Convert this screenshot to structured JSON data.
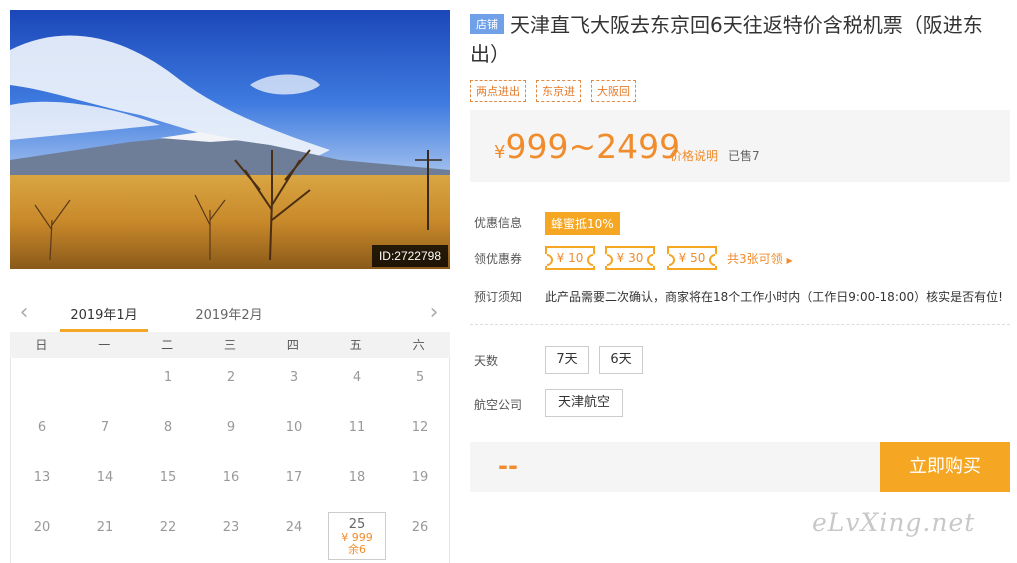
{
  "product": {
    "image_id": "ID:2722798",
    "shop_badge": "店铺",
    "title": "天津直飞大阪去东京回6天往返特价含税机票（阪进东出）",
    "tags": [
      "两点进出",
      "东京进",
      "大阪回"
    ]
  },
  "price": {
    "currency": "¥",
    "range": "999~2499",
    "note": "价格说明",
    "sold": "已售7"
  },
  "promo": {
    "label": "优惠信息",
    "badge": "蜂蜜抵10%",
    "coupon_label": "领优惠券",
    "coupons": [
      "¥ 10",
      "¥ 30",
      "¥ 50"
    ],
    "coupon_more": "共3张可领",
    "notice_label": "预订须知",
    "notice": "此产品需要二次确认，商家将在18个工作小时内（工作日9:00-18:00）核实是否有位!"
  },
  "options": {
    "days_label": "天数",
    "days": [
      "7天",
      "6天"
    ],
    "airline_label": "航空公司",
    "airlines": [
      "天津航空"
    ]
  },
  "purchase": {
    "total": "--",
    "buy_label": "立即购买"
  },
  "calendar": {
    "months": [
      "2019年1月",
      "2019年2月"
    ],
    "weekdays": [
      "日",
      "一",
      "二",
      "三",
      "四",
      "五",
      "六"
    ],
    "rows": [
      [
        "",
        "",
        "1",
        "2",
        "3",
        "4",
        "5"
      ],
      [
        "6",
        "7",
        "8",
        "9",
        "10",
        "11",
        "12"
      ],
      [
        "13",
        "14",
        "15",
        "16",
        "17",
        "18",
        "19"
      ],
      [
        "20",
        "21",
        "22",
        "23",
        "24",
        "25",
        "26"
      ]
    ],
    "available": {
      "day": "25",
      "price": "¥ 999",
      "stock": "余6"
    }
  },
  "watermark": "eLvXing.net",
  "colors": {
    "accent": "#f5a623",
    "accent_text": "#f08c2b",
    "shop_badge": "#6fa0e8"
  }
}
